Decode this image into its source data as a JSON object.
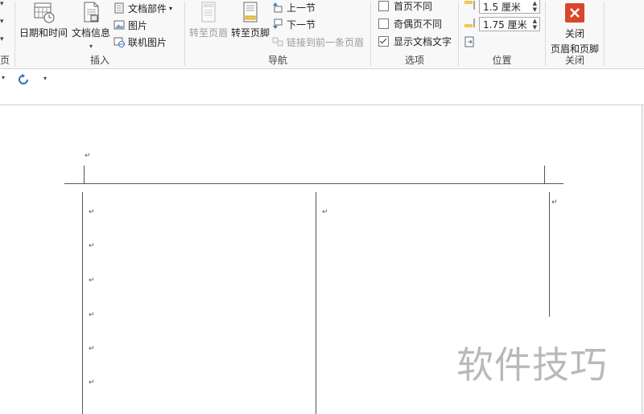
{
  "ribbon": {
    "edge_label": "页脚",
    "insert": {
      "group_label": "插入",
      "datetime_label": "日期和时间",
      "docinfo_label": "文档信息",
      "doc_parts_label": "文档部件",
      "picture_label": "图片",
      "online_picture_label": "联机图片"
    },
    "navigation": {
      "group_label": "导航",
      "goto_header_label": "转至页眉",
      "goto_footer_label": "转至页脚",
      "prev_section_label": "上一节",
      "next_section_label": "下一节",
      "link_prev_label": "链接到前一条页眉"
    },
    "options": {
      "group_label": "选项",
      "first_page_label": "首页不同",
      "odd_even_label": "奇偶页不同",
      "show_text_label": "显示文档文字",
      "first_page_checked": false,
      "odd_even_checked": false,
      "show_text_checked": true
    },
    "position": {
      "group_label": "位置",
      "header_distance": "1.5 厘米",
      "footer_distance": "1.75 厘米"
    },
    "close": {
      "group_label": "关闭",
      "close_label_line1": "关闭",
      "close_label_line2": "页眉和页脚",
      "accent": "#d9472b"
    }
  },
  "document": {
    "paragraph_mark": "↵"
  },
  "watermark": {
    "text": "软件技巧"
  }
}
